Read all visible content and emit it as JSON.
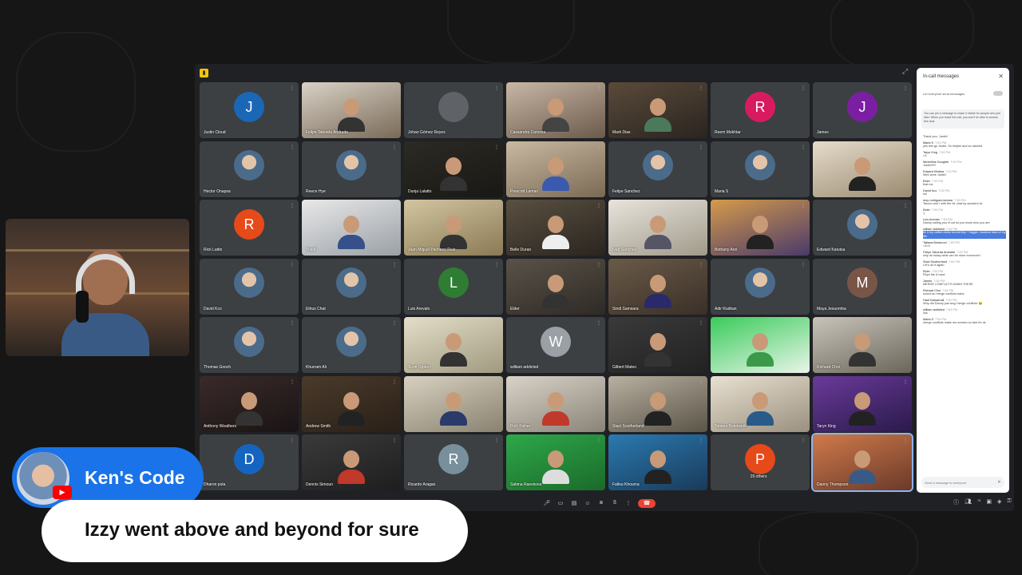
{
  "meeting": {
    "tiles": [
      {
        "name": "Justin Cloud",
        "type": "avatar",
        "letter": "J",
        "color": "#1a67b6"
      },
      {
        "name": "Felipe Taborda Andrade",
        "type": "video",
        "c1": "#d8d2c6",
        "c2": "#7a6a58",
        "shirt": "#333"
      },
      {
        "name": "Johan Gómez Reyes",
        "type": "avatar",
        "letter": "",
        "color": "#5f6368",
        "icon": "logo-icon"
      },
      {
        "name": "Cassandra Carozza",
        "type": "video",
        "c1": "#c8b7a6",
        "c2": "#6b5a4a",
        "shirt": "#444"
      },
      {
        "name": "Mark Dias",
        "type": "video",
        "c1": "#5a4a3a",
        "c2": "#2a2520",
        "shirt": "#4a7a5a"
      },
      {
        "name": "Reem Mokhtar",
        "type": "avatar",
        "letter": "R",
        "color": "#d81b60"
      },
      {
        "name": "James",
        "type": "avatar",
        "letter": "J",
        "color": "#7b1fa2"
      },
      {
        "name": "Hector Onapsa",
        "type": "avatar",
        "letter": "",
        "color": "photo"
      },
      {
        "name": "Reece Hye",
        "type": "avatar",
        "letter": "",
        "color": "photo"
      },
      {
        "name": "Dunja Lalatto",
        "type": "video",
        "c1": "#2c2a24",
        "c2": "#1a1814",
        "shirt": "#333"
      },
      {
        "name": "Prescott Lamao",
        "type": "video",
        "c1": "#c9b9a2",
        "c2": "#7a6a55",
        "shirt": "#3a5ab0"
      },
      {
        "name": "Felipe Sanchez",
        "type": "avatar",
        "letter": "",
        "color": "photo"
      },
      {
        "name": "Maria S",
        "type": "avatar",
        "letter": "",
        "color": "photo"
      },
      {
        "name": "",
        "type": "video",
        "c1": "#e6dccb",
        "c2": "#9a8a70",
        "shirt": "#222"
      },
      {
        "name": "Rick Lattin",
        "type": "avatar",
        "letter": "R",
        "color": "#e64a19"
      },
      {
        "name": "Yusuf",
        "type": "video",
        "c1": "#e8e8e8",
        "c2": "#9aa0a6",
        "shirt": "#36508a"
      },
      {
        "name": "Juan Miguel Pacheco Ruiz",
        "type": "video",
        "c1": "#d2c5a0",
        "c2": "#8a7a55",
        "shirt": "#333"
      },
      {
        "name": "Belle Duran",
        "type": "video",
        "c1": "#5a5040",
        "c2": "#2a2520",
        "shirt": "#eee"
      },
      {
        "name": "Ivan Sanchez",
        "type": "video",
        "c1": "#e8e4dc",
        "c2": "#a09a8a",
        "shirt": "#556"
      },
      {
        "name": "Bethany Ann",
        "type": "video",
        "c1": "#d59a4a",
        "c2": "#4a3a6a",
        "shirt": "#222"
      },
      {
        "name": "Edward Katutsa",
        "type": "avatar",
        "letter": "",
        "color": "photo"
      },
      {
        "name": "David Kco",
        "type": "avatar",
        "letter": "",
        "color": "photo"
      },
      {
        "name": "Eltrus Chat",
        "type": "avatar",
        "letter": "",
        "color": "photo"
      },
      {
        "name": "Luis Arevalo",
        "type": "avatar",
        "letter": "L",
        "color": "#2e7d32"
      },
      {
        "name": "Elder",
        "type": "video",
        "c1": "#5a5248",
        "c2": "#2e2a26",
        "shirt": "#333"
      },
      {
        "name": "Sindi Samsara",
        "type": "video",
        "c1": "#6a5a48",
        "c2": "#3a3028",
        "shirt": "#2a2a6a"
      },
      {
        "name": "Adir Rudkan",
        "type": "avatar",
        "letter": "",
        "color": "photo"
      },
      {
        "name": "Maya Jesuomba",
        "type": "avatar",
        "letter": "M",
        "color": "#795548"
      },
      {
        "name": "Thomas Gooch",
        "type": "avatar",
        "letter": "",
        "color": "photo"
      },
      {
        "name": "Khurram Ali",
        "type": "avatar",
        "letter": "",
        "color": "photo"
      },
      {
        "name": "Scott Ogden",
        "type": "video",
        "c1": "#e4ddc8",
        "c2": "#a09a80",
        "shirt": "#333"
      },
      {
        "name": "william addicted",
        "type": "avatar",
        "letter": "W",
        "color": "#9aa0a6"
      },
      {
        "name": "Gilbert Mateo",
        "type": "video",
        "c1": "#3a3a3a",
        "c2": "#222",
        "shirt": "#333"
      },
      {
        "name": "",
        "type": "video",
        "c1": "#3acb5a",
        "c2": "#e8f5e9",
        "shirt": "#3a9a4a"
      },
      {
        "name": "Richard Choi",
        "type": "video",
        "c1": "#c8c4ba",
        "c2": "#6a665a",
        "shirt": "#333"
      },
      {
        "name": "Anthony Weathers",
        "type": "video",
        "c1": "#3a2a2a",
        "c2": "#1a1414",
        "shirt": "#333"
      },
      {
        "name": "Andrew Smith",
        "type": "video",
        "c1": "#4a3a2a",
        "c2": "#2a2018",
        "shirt": "#222"
      },
      {
        "name": "",
        "type": "video",
        "c1": "#d8d0c0",
        "c2": "#8a8270",
        "shirt": "#2a3a6a"
      },
      {
        "name": "Rich Fisher",
        "type": "video",
        "c1": "#d8d2c8",
        "c2": "#8a8478",
        "shirt": "#c0392b"
      },
      {
        "name": "Staci Southerland",
        "type": "video",
        "c1": "#b8b0a0",
        "c2": "#5a5448",
        "shirt": "#222"
      },
      {
        "name": "Tatiana Bondazoli",
        "type": "video",
        "c1": "#e8e0d0",
        "c2": "#9a9080",
        "shirt": "#2a5a8a"
      },
      {
        "name": "Taryn King",
        "type": "video",
        "c1": "#6a3a9a",
        "c2": "#2a1a4a",
        "shirt": "#222"
      },
      {
        "name": "Dharon pola",
        "type": "avatar",
        "letter": "D",
        "color": "#1565c0"
      },
      {
        "name": "Dennis Simoun",
        "type": "video",
        "c1": "#3a3a3a",
        "c2": "#1e1e1e",
        "shirt": "#c0392b"
      },
      {
        "name": "Ricardo Aragao",
        "type": "avatar",
        "letter": "R",
        "color": "#78909c"
      },
      {
        "name": "Sabina Raevkova",
        "type": "video",
        "c1": "#2ea84a",
        "c2": "#1a6a2a",
        "shirt": "#ddd"
      },
      {
        "name": "Fallou Khouma",
        "type": "video",
        "c1": "#2a7ab0",
        "c2": "#1a3a5a",
        "shirt": "#222"
      },
      {
        "name": "29 others",
        "type": "others",
        "letter": "P",
        "color": "#e64a19"
      },
      {
        "name": "Danny Thompson",
        "type": "video",
        "c1": "#d07a4a",
        "c2": "#6a3a2a",
        "shirt": "#3a5a86",
        "active": true
      }
    ],
    "controls": [
      "mic-icon",
      "camera-icon",
      "captions-icon",
      "emoji-icon",
      "present-icon",
      "raise-hand-icon",
      "more-icon",
      "end-call-icon"
    ],
    "right_icons": [
      "info-icon",
      "people-icon",
      "chat-icon",
      "activities-icon",
      "lock-icon"
    ],
    "people_count": "78"
  },
  "chat": {
    "title": "In-call messages",
    "toggle_label": "Let everyone send messages",
    "notice": "You can pin a message to make it visible for people who join later. When you leave the call, you won't be able to access this chat.",
    "messages": [
      {
        "who": "",
        "time": "",
        "text": "Thank you, Justin!"
      },
      {
        "who": "Maria S",
        "time": "7:52 PM",
        "text": "yes lets go Justin. So helpful and so dashed"
      },
      {
        "who": "Taryn King",
        "time": "7:52 PM",
        "text": "<3"
      },
      {
        "who": "Michelline Doughte",
        "time": "7:53 PM",
        "text": "Justin!!!!!!"
      },
      {
        "who": "Edward Kitsitsa",
        "time": "7:53 PM",
        "text": "Well done Justin!"
      },
      {
        "who": "Elder",
        "time": "7:53 PM",
        "text": "that me"
      },
      {
        "who": "David Kco",
        "time": "7:53 PM",
        "text": "loll"
      },
      {
        "who": "moy rodriguez-beckwr",
        "time": "7:53 PM",
        "text": "Taroon and I with the NL chat by accident lol"
      },
      {
        "who": "Elder",
        "time": "7:53 PM",
        "text": ":)"
      },
      {
        "who": "Luis Arevalo",
        "time": "7:53 PM",
        "text": "Danny calling you lil out lol you know who you are",
        "hl": false
      },
      {
        "who": "william addicted",
        "time": "7:53 PM",
        "text": "fiz it my coffee cheks turned tiny + bigger, mustnce idea of my life",
        "hl": true
      },
      {
        "who": "Tatiana Bentoroni",
        "time": "7:53 PM",
        "text": "<3<3"
      },
      {
        "who": "Felipe Taborda Andrade",
        "time": "7:53 PM",
        "text": "why do today what can be done tomorrow?"
      },
      {
        "who": "Staci Southerland",
        "time": "7:54 PM",
        "text": "Let's do it again"
      },
      {
        "who": "Elder",
        "time": "7:54 PM",
        "text": "Rhyn fits & have"
      },
      {
        "who": "James",
        "time": "7:54 PM",
        "text": "MERGE CONFLICTS DAWN THESE"
      },
      {
        "who": "Richard Choi",
        "time": "7:54 PM",
        "text": "sound so merge conflicts haha"
      },
      {
        "who": "Hadi Kassamali",
        "time": "7:54 PM",
        "text": "Why did Danny just sing 'merge conflicts' 😂"
      },
      {
        "who": "william addicted",
        "time": "7:54 PM",
        "text": "lols"
      },
      {
        "who": "Maria S",
        "time": "7:54 PM",
        "text": "merge conflicts make me scream so fast it's ok"
      }
    ],
    "input_placeholder": "Send a message to everyone"
  },
  "overlay": {
    "channel_name": "Ken's Code",
    "caption": "Izzy went above and beyond for sure"
  }
}
